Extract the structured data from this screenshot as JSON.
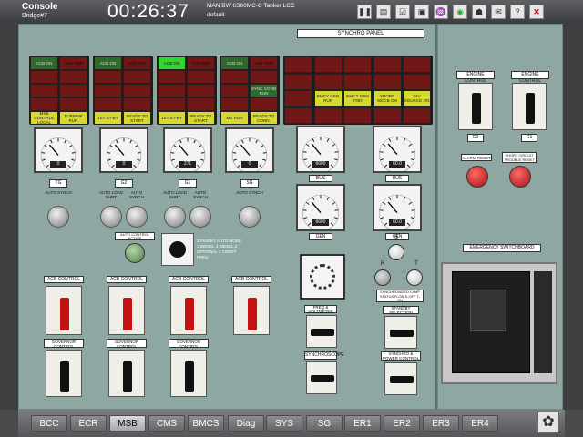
{
  "header": {
    "title": "Console",
    "subtitle": "Bridge#7",
    "clock": "00:26:37",
    "ship": "MAN BW 6S60MC-C Tanker LCC",
    "profile": "default"
  },
  "toolbar_icons": [
    "pause-icon",
    "scenario-icon",
    "checklist-icon",
    "alarm-list-icon",
    "horn-icon",
    "sound-icon",
    "group-icon",
    "chat-icon",
    "help-icon",
    "close-icon"
  ],
  "panel": {
    "title": "SYNCHRO PANEL",
    "emergency_title": "EMERGENCY SWITCHBOARD"
  },
  "gen_groups": [
    {
      "lamps": [
        {
          "t": "ACB ON",
          "c": "green"
        },
        {
          "t": "ACB TRIP",
          "c": "red"
        },
        {
          "t": "",
          "c": "red"
        },
        {
          "t": "",
          "c": "red"
        },
        {
          "t": "",
          "c": "red"
        },
        {
          "t": "",
          "c": "red"
        },
        {
          "t": "",
          "c": "red"
        },
        {
          "t": "",
          "c": "red"
        },
        {
          "t": "MSB CONTROL LOCAL",
          "c": "yellow"
        },
        {
          "t": "TURBINE RUN",
          "c": "yellow"
        }
      ]
    },
    {
      "lamps": [
        {
          "t": "ACB ON",
          "c": "green"
        },
        {
          "t": "ACB TRIP",
          "c": "red"
        },
        {
          "t": "",
          "c": "red"
        },
        {
          "t": "",
          "c": "red"
        },
        {
          "t": "",
          "c": "red"
        },
        {
          "t": "",
          "c": "red"
        },
        {
          "t": "",
          "c": "red"
        },
        {
          "t": "",
          "c": "red"
        },
        {
          "t": "1ST ST-BY",
          "c": "yellow"
        },
        {
          "t": "READY TO START",
          "c": "yellow"
        }
      ]
    },
    {
      "lamps": [
        {
          "t": "ACB ON",
          "c": "bgreen"
        },
        {
          "t": "ACB TRIP",
          "c": "red"
        },
        {
          "t": "",
          "c": "red"
        },
        {
          "t": "",
          "c": "red"
        },
        {
          "t": "",
          "c": "red"
        },
        {
          "t": "",
          "c": "red"
        },
        {
          "t": "",
          "c": "red"
        },
        {
          "t": "",
          "c": "red"
        },
        {
          "t": "1ST ST-BY",
          "c": "yellow"
        },
        {
          "t": "READY TO START",
          "c": "yellow"
        }
      ]
    },
    {
      "lamps": [
        {
          "t": "ACB ON",
          "c": "green"
        },
        {
          "t": "ACB TRIP",
          "c": "red"
        },
        {
          "t": "",
          "c": "red"
        },
        {
          "t": "",
          "c": "red"
        },
        {
          "t": "",
          "c": "red"
        },
        {
          "t": "SYNC COND RUN",
          "c": "green"
        },
        {
          "t": "",
          "c": "red"
        },
        {
          "t": "",
          "c": "red"
        },
        {
          "t": "ME RUN",
          "c": "yellow"
        },
        {
          "t": "READY TO CONN.",
          "c": "yellow"
        }
      ]
    }
  ],
  "bus_lamps": [
    {
      "t": "",
      "c": "red"
    },
    {
      "t": "",
      "c": "red"
    },
    {
      "t": "",
      "c": "red"
    },
    {
      "t": "",
      "c": "red"
    },
    {
      "t": "",
      "c": "red"
    },
    {
      "t": "",
      "c": "red"
    },
    {
      "t": "",
      "c": "red"
    },
    {
      "t": "",
      "c": "red"
    },
    {
      "t": "",
      "c": "red"
    },
    {
      "t": "",
      "c": "red"
    },
    {
      "t": "",
      "c": "red"
    },
    {
      "t": "EMCY GEN RUN",
      "c": "yellow"
    },
    {
      "t": "EMCY GEN STBY",
      "c": "yellow"
    },
    {
      "t": "SHORE MCCB ON",
      "c": "yellow"
    },
    {
      "t": "24V SOURCE ON",
      "c": "yellow"
    },
    {
      "t": "",
      "c": "red"
    },
    {
      "t": "",
      "c": "red"
    },
    {
      "t": "",
      "c": "red"
    },
    {
      "t": "",
      "c": "red"
    },
    {
      "t": "",
      "c": "red"
    }
  ],
  "generators": [
    {
      "name": "TG",
      "kw": "0",
      "sub": [
        "AUTO SYNCH"
      ]
    },
    {
      "name": "G2",
      "kw": "0",
      "sub": [
        "AUTO LOAD SHRT",
        "AUTO SYNCH"
      ]
    },
    {
      "name": "G1",
      "kw": "271",
      "sub": [
        "AUTO LOAD SHRT",
        "AUTO SYNCH"
      ]
    },
    {
      "name": "SG",
      "kw": "0",
      "sub": [
        "AUTO SYNCH"
      ]
    }
  ],
  "bus_meters": [
    {
      "label": "BUS",
      "read": "6600"
    },
    {
      "label": "BUS",
      "read": "60.0"
    },
    {
      "label": "GEN",
      "read": "6600"
    },
    {
      "label": "GEN",
      "read": "60.0"
    }
  ],
  "controls": {
    "auto_control": "AUTO CONTROL ACTIVE",
    "stby_text": "STANDBY AUTO MODE 1 DIESEL 2 DIESEL 3 OPTIONAL 4 CONST FREQ",
    "acb_control": [
      "ACB CONTROL",
      "ACB CONTROL",
      "ACB CONTROL",
      "ACB CONTROL"
    ],
    "governor_control": [
      "GOVERNOR CONTROL",
      "GOVERNOR CONTROL",
      "GOVERNOR CONTROL"
    ],
    "synchronized_lamp": "SYNCHRONIZED LAMP STATUS R-ON S-OFF T-ON",
    "freq_voltmeter": "FREQ & VOLTMETER",
    "synchroscope": "SYNCHROSCOPE",
    "standby_selection": "STANDBY SELECTION",
    "synchro_power": "SYNCHRO & POWER CONTROL"
  },
  "emergency": {
    "engine_control": "ENGINE CONTROL",
    "engine_control2": "ENGINE CONTROL",
    "g2": "G2",
    "g1": "G1",
    "alarm_reset": "ALARM RESET",
    "short_circuit": "SHORT CIRCUIT TROUBLE RESET"
  },
  "tabs": [
    "BCC",
    "ECR",
    "MSB",
    "CMS",
    "BMCS",
    "Diag",
    "SYS",
    "SG",
    "ER1",
    "ER2",
    "ER3",
    "ER4"
  ],
  "active_tab": "MSB"
}
